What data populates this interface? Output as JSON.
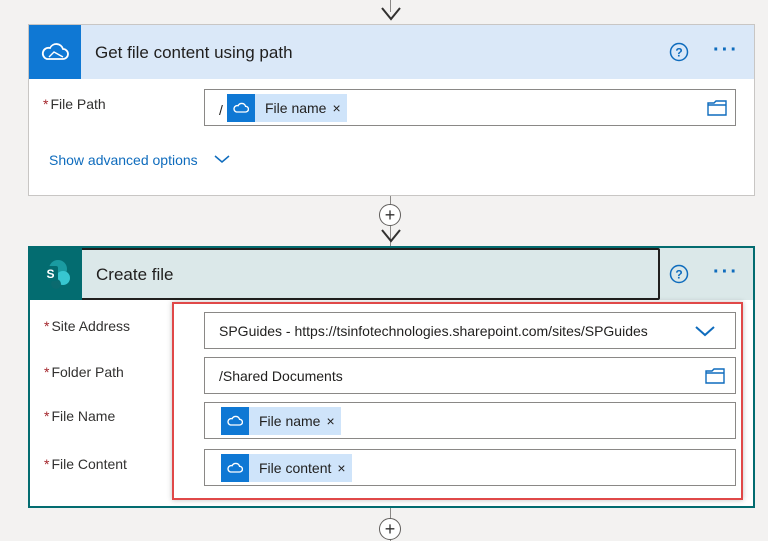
{
  "colors": {
    "accent": "#0f6cbd",
    "highlight": "#e04848",
    "sharepoint_green": "#036c70"
  },
  "onedrive_action": {
    "title": "Get file content using path",
    "icon": "onedrive-cloud-icon",
    "fields": [
      {
        "label": "File Path",
        "required_mark": "*",
        "prefix": "/",
        "token": "File name",
        "token_close": "×"
      }
    ],
    "advanced_options": "Show advanced options"
  },
  "create_file_action": {
    "title": "Create file",
    "icon": "sharepoint-icon",
    "icon_letter": "S",
    "fields": [
      {
        "label": "Site Address",
        "required_mark": "*",
        "value": "SPGuides - https://tsinfotechnologies.sharepoint.com/sites/SPGuides"
      },
      {
        "label": "Folder Path",
        "required_mark": "*",
        "value": "/Shared Documents"
      },
      {
        "label": "File Name",
        "required_mark": "*",
        "token": "File name",
        "token_close": "×"
      },
      {
        "label": "File Content",
        "required_mark": "*",
        "token": "File content",
        "token_close": "×"
      }
    ]
  },
  "connectors": {
    "add_step": "+"
  }
}
